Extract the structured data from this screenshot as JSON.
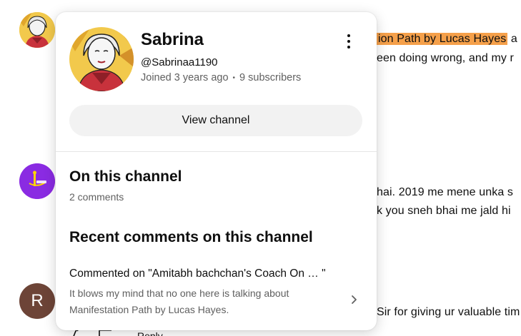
{
  "background": {
    "comments": [
      {
        "line1_highlight": "ion Path by Lucas Hayes",
        "line1_after": " a",
        "line2": "een doing wrong, and my r"
      },
      {
        "line1": " hai. 2019 me mene unka s",
        "line2": "k you sneh bhai me jald hi"
      },
      {
        "line1": "Sir for giving ur valuable tim"
      }
    ],
    "avatar3_letter": "R",
    "reply_label": "Reply"
  },
  "profile": {
    "name": "Sabrina",
    "handle": "@Sabrinaa1190",
    "joined": "Joined 3 years ago",
    "subscribers": "9 subscribers",
    "view_channel_label": "View channel"
  },
  "on_channel": {
    "title": "On this channel",
    "comment_count": "2 comments"
  },
  "recent": {
    "title": "Recent comments on this channel",
    "items": [
      {
        "commented_on": "Commented on \"Amitabh bachchan's Coach On …  \"",
        "text": "It blows my mind that no one here is talking about Manifestation Path by Lucas Hayes."
      }
    ]
  },
  "colors": {
    "highlight": "#f5a04a",
    "secondary_text": "#606060",
    "button_bg": "#f2f2f2"
  }
}
